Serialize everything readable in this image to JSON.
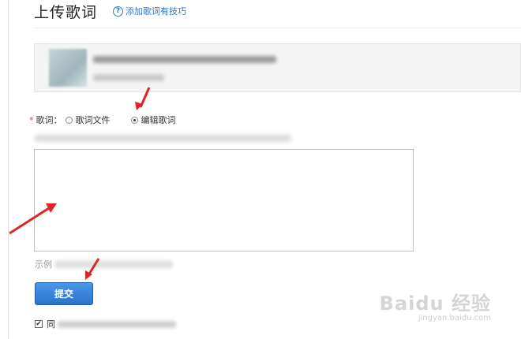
{
  "header": {
    "title": "上传歌词",
    "tips_link": "添加歌词有技巧",
    "tips_icon": "help-circle-icon"
  },
  "form": {
    "required_mark": "*",
    "lyrics_label": "歌词：",
    "options": [
      {
        "label": "歌词文件",
        "selected": false
      },
      {
        "label": "编辑歌词",
        "selected": true
      }
    ],
    "lyrics_value": "",
    "example_prefix": "示例",
    "submit_label": "提交",
    "agree_prefix": "同",
    "agree_checked": true
  },
  "watermark": {
    "main": "Baidu 经验",
    "sub": "jingyan.baidu.com"
  },
  "colors": {
    "link": "#2b78d3",
    "button": "#2a74cc",
    "annotation_arrow": "#e02424",
    "required": "#e23b3b"
  }
}
